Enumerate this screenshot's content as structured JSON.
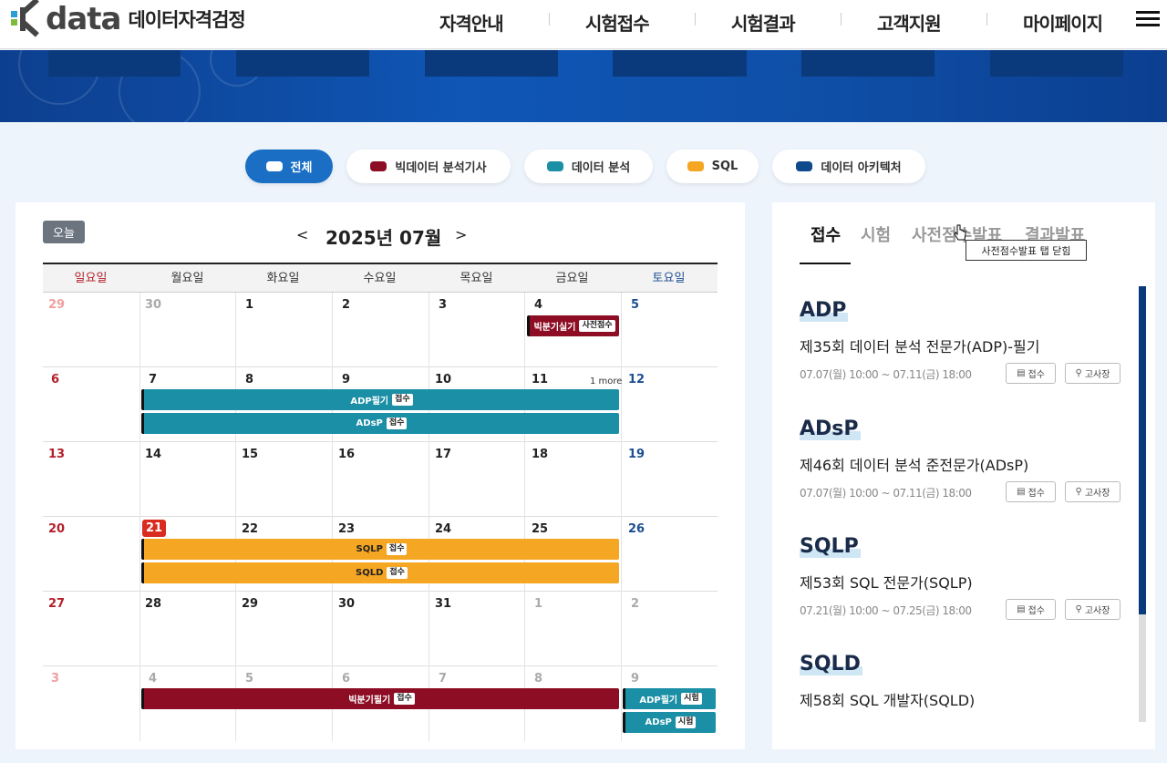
{
  "brand": {
    "data": "data",
    "sub": "데이터자격검정"
  },
  "nav": [
    "자격안내",
    "시험접수",
    "시험결과",
    "고객지원",
    "마이페이지"
  ],
  "filters": [
    {
      "label": "전체",
      "color": "#ffffff",
      "active": true
    },
    {
      "label": "빅데이터 분석기사",
      "color": "#8c0d24"
    },
    {
      "label": "데이터 분석",
      "color": "#1b8fa6"
    },
    {
      "label": "SQL",
      "color": "#f5a623"
    },
    {
      "label": "데이터 아키텍처",
      "color": "#0e4a8c"
    }
  ],
  "calendar": {
    "today_btn": "오늘",
    "prev": "<",
    "next": ">",
    "month": "2025년 07월",
    "weekdays": [
      "일요일",
      "월요일",
      "화요일",
      "수요일",
      "목요일",
      "금요일",
      "토요일"
    ],
    "more": "1 more"
  },
  "events": {
    "bigdata_real": {
      "name": "빅분기실기",
      "tag": "사전점수"
    },
    "adp_write": {
      "name": "ADP필기",
      "tag": "접수"
    },
    "adsp": {
      "name": "ADsP",
      "tag": "접수"
    },
    "sqlp": {
      "name": "SQLP",
      "tag": "접수"
    },
    "sqld": {
      "name": "SQLD",
      "tag": "접수"
    },
    "bigdata_write": {
      "name": "빅분기필기",
      "tag": "접수"
    },
    "adp_exam": {
      "name": "ADP필기",
      "tag": "시험"
    },
    "adsp_exam": {
      "name": "ADsP",
      "tag": "시험"
    }
  },
  "side": {
    "tabs": [
      "접수",
      "시험",
      "사전점수발표",
      "결과발표"
    ],
    "tooltip": "사전점수발표 탭 닫힘",
    "items": [
      {
        "name": "ADP",
        "title": "제35회 데이터 분석 전문가(ADP)-필기",
        "date": "07.07(월) 10:00 ~ 07.11(금) 18:00"
      },
      {
        "name": "ADsP",
        "title": "제46회 데이터 분석 준전문가(ADsP)",
        "date": "07.07(월) 10:00 ~ 07.11(금) 18:00"
      },
      {
        "name": "SQLP",
        "title": "제53회 SQL 전문가(SQLP)",
        "date": "07.21(월) 10:00 ~ 07.25(금) 18:00"
      },
      {
        "name": "SQLD",
        "title": "제58회 SQL 개발자(SQLD)",
        "date": ""
      }
    ],
    "btn_apply": "접수",
    "btn_venue": "고사장"
  }
}
